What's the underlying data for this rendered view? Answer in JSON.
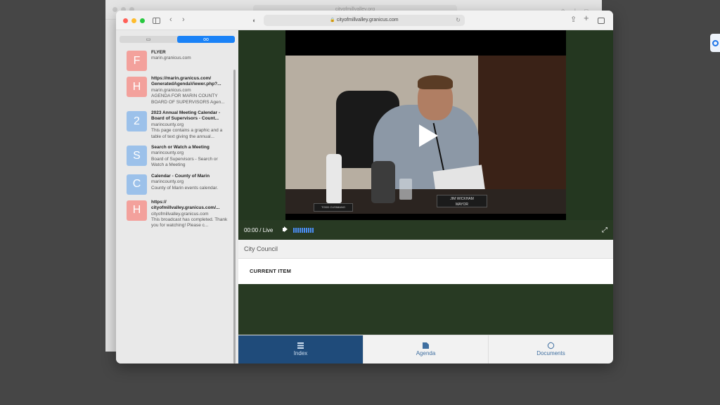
{
  "background_window": {
    "url": "cityofmillvalley.org"
  },
  "main_window": {
    "url": "cityofmillvalley.granicus.com"
  },
  "sidebar": {
    "segments": [
      {
        "icon": "book-icon"
      },
      {
        "icon": "reading-list-icon",
        "active": true
      }
    ],
    "items": [
      {
        "letter": "F",
        "color": "#f3a19c",
        "title": "FLYER",
        "lines": [
          "marin.granicus.com"
        ]
      },
      {
        "letter": "H",
        "color": "#f3a19c",
        "title": "https://marin.granicus.com/ GeneratedAgendaViewer.php?...",
        "lines": [
          "marin.granicus.com",
          "AGENDA FOR MARIN COUNTY BOARD OF SUPERVISORS Agen..."
        ]
      },
      {
        "letter": "2",
        "color": "#9cc1ea",
        "title": "2023 Annual Meeting Calendar - Board of Supervisors - Count...",
        "lines": [
          "marincounty.org",
          "This page contains a graphic and a table of text giving the annual..."
        ]
      },
      {
        "letter": "S",
        "color": "#9cc1ea",
        "title": "Search or Watch a Meeting",
        "lines": [
          "marincounty.org",
          "Board of Supervisors - Search or Watch a Meeting"
        ]
      },
      {
        "letter": "C",
        "color": "#9cc1ea",
        "title": "Calendar - County of Marin",
        "lines": [
          "marincounty.org",
          "County of Marin events calendar."
        ]
      },
      {
        "letter": "H",
        "color": "#f3a19c",
        "title": "https:// cityofmillvalley.granicus.com/...",
        "lines": [
          "cityofmillvalley.granicus.com",
          "This broadcast has completed. Thank you for watching! Please c..."
        ]
      }
    ]
  },
  "player": {
    "time": "00:00 / Live",
    "volume_level": 1.0,
    "nameplate_main": "JIM WICKHAM",
    "nameplate_main_sub": "MAYOR",
    "nameplate_left": "TODD CUSIMANO"
  },
  "meeting": {
    "body_name": "City Council",
    "current_item_label": "CURRENT ITEM"
  },
  "tabs": [
    {
      "label": "Index",
      "icon": "index-icon",
      "active": true
    },
    {
      "label": "Agenda",
      "icon": "agenda-doc-icon",
      "active": false
    },
    {
      "label": "Documents",
      "icon": "paperclip-icon",
      "active": false
    }
  ]
}
